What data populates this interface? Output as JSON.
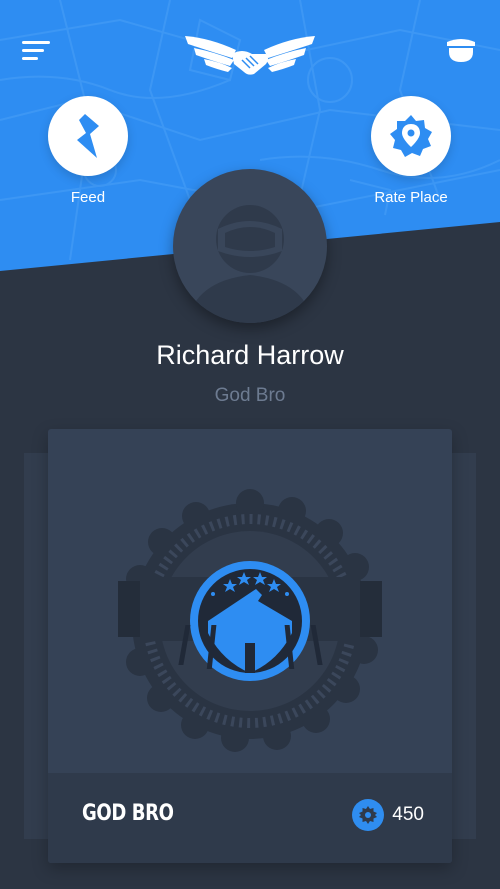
{
  "colors": {
    "brand_blue": "#2e8df2",
    "background": "#2c3543",
    "card": "#354256"
  },
  "header": {
    "menu_icon": "hamburger-menu-icon",
    "logo_icon": "winged-handshake-logo",
    "profile_icon": "cap-icon"
  },
  "actions": [
    {
      "label": "Feed",
      "icon": "lightning-icon"
    },
    {
      "label": "Rate Place",
      "icon": "location-pin-icon"
    }
  ],
  "profile": {
    "name": "Richard Harrow",
    "title": "God Bro"
  },
  "badge_card": {
    "badge_name": "GOD BRO",
    "points": "450",
    "points_icon": "gear-badge-icon",
    "badge_icon": "eagle-shield-emblem"
  }
}
